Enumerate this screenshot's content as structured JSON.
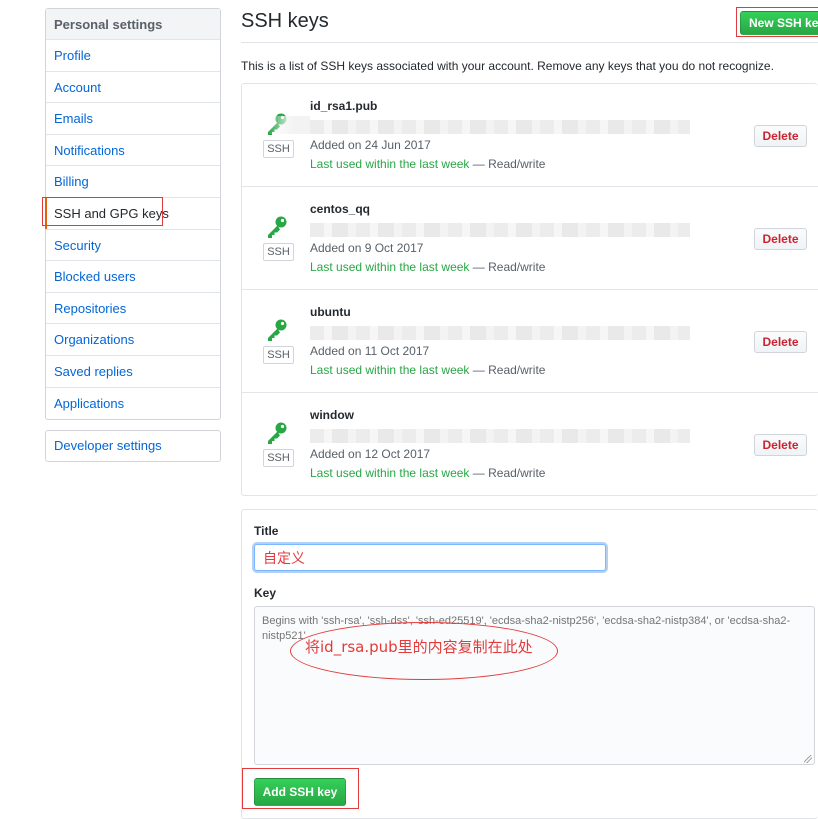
{
  "sidebar": {
    "heading": "Personal settings",
    "items": [
      {
        "label": "Profile"
      },
      {
        "label": "Account"
      },
      {
        "label": "Emails"
      },
      {
        "label": "Notifications"
      },
      {
        "label": "Billing"
      },
      {
        "label": "SSH and GPG keys",
        "selected": true
      },
      {
        "label": "Security"
      },
      {
        "label": "Blocked users"
      },
      {
        "label": "Repositories"
      },
      {
        "label": "Organizations"
      },
      {
        "label": "Saved replies"
      },
      {
        "label": "Applications"
      }
    ],
    "developer": "Developer settings"
  },
  "main": {
    "title": "SSH keys",
    "new_button": "New SSH key",
    "intro": "This is a list of SSH keys associated with your account. Remove any keys that you do not recognize.",
    "keys": [
      {
        "title": "id_rsa1.pub",
        "badge": "SSH",
        "added": "Added on 24 Jun 2017",
        "used": "Last used within the last week",
        "access": "— Read/write",
        "delete": "Delete"
      },
      {
        "title": "centos_qq",
        "badge": "SSH",
        "added": "Added on 9 Oct 2017",
        "used": "Last used within the last week",
        "access": "— Read/write",
        "delete": "Delete"
      },
      {
        "title": "ubuntu",
        "badge": "SSH",
        "added": "Added on 11 Oct 2017",
        "used": "Last used within the last week",
        "access": "— Read/write",
        "delete": "Delete"
      },
      {
        "title": "window",
        "badge": "SSH",
        "added": "Added on 12 Oct 2017",
        "used": "Last used within the last week",
        "access": "— Read/write",
        "delete": "Delete"
      }
    ]
  },
  "form": {
    "title_label": "Title",
    "title_value": "自定义",
    "key_label": "Key",
    "key_placeholder": "Begins with 'ssh-rsa', 'ssh-dss', 'ssh-ed25519', 'ecdsa-sha2-nistp256', 'ecdsa-sha2-nistp384', or 'ecdsa-sha2-nistp521'",
    "annotation": "将id_rsa.pub里的内容复制在此处",
    "add_button": "Add SSH key"
  },
  "colors": {
    "link": "#0366d6",
    "green": "#28a745",
    "danger": "#cb2431",
    "annotation_red": "#e23b3b"
  },
  "icons": {
    "key": "key-icon",
    "resize": "resize-grip-icon"
  }
}
